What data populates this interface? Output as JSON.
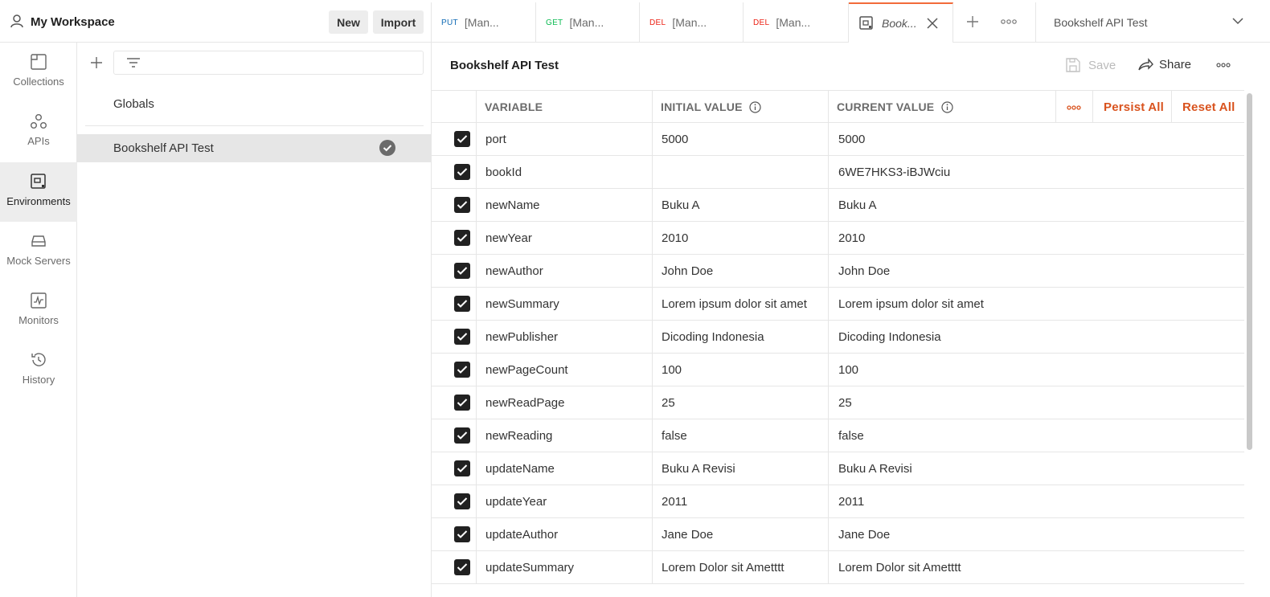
{
  "workspace": {
    "title": "My Workspace",
    "new_label": "New",
    "import_label": "Import"
  },
  "tabs": [
    {
      "method": "PUT",
      "method_color": "#0f6ab4",
      "label": "[Man..."
    },
    {
      "method": "GET",
      "method_color": "#0cbb52",
      "label": "[Man..."
    },
    {
      "method": "DEL",
      "method_color": "#eb2013",
      "label": "[Man..."
    },
    {
      "method": "DEL",
      "method_color": "#eb2013",
      "label": "[Man..."
    },
    {
      "label": "Book..."
    }
  ],
  "env_selector": "Bookshelf API Test",
  "rail": [
    {
      "label": "Collections",
      "icon": "collections-icon"
    },
    {
      "label": "APIs",
      "icon": "apis-icon"
    },
    {
      "label": "Environments",
      "icon": "environments-icon"
    },
    {
      "label": "Mock Servers",
      "icon": "mock-servers-icon"
    },
    {
      "label": "Monitors",
      "icon": "monitors-icon"
    },
    {
      "label": "History",
      "icon": "history-icon"
    }
  ],
  "env_list": {
    "globals": "Globals",
    "items": [
      "Bookshelf API Test"
    ]
  },
  "main": {
    "title": "Bookshelf API Test",
    "save_label": "Save",
    "share_label": "Share",
    "persist_all": "Persist All",
    "reset_all": "Reset All"
  },
  "table": {
    "headers": {
      "variable": "VARIABLE",
      "initial": "INITIAL VALUE",
      "current": "CURRENT VALUE"
    },
    "rows": [
      {
        "variable": "port",
        "initial": "5000",
        "current": "5000"
      },
      {
        "variable": "bookId",
        "initial": "",
        "current": "6WE7HKS3-iBJWciu"
      },
      {
        "variable": "newName",
        "initial": "Buku A",
        "current": "Buku A"
      },
      {
        "variable": "newYear",
        "initial": "2010",
        "current": "2010"
      },
      {
        "variable": "newAuthor",
        "initial": "John Doe",
        "current": "John Doe"
      },
      {
        "variable": "newSummary",
        "initial": "Lorem ipsum dolor sit amet",
        "current": "Lorem ipsum dolor sit amet"
      },
      {
        "variable": "newPublisher",
        "initial": "Dicoding Indonesia",
        "current": "Dicoding Indonesia"
      },
      {
        "variable": "newPageCount",
        "initial": "100",
        "current": "100"
      },
      {
        "variable": "newReadPage",
        "initial": "25",
        "current": "25"
      },
      {
        "variable": "newReading",
        "initial": "false",
        "current": "false"
      },
      {
        "variable": "updateName",
        "initial": "Buku A Revisi",
        "current": "Buku A Revisi"
      },
      {
        "variable": "updateYear",
        "initial": "2011",
        "current": "2011"
      },
      {
        "variable": "updateAuthor",
        "initial": "Jane Doe",
        "current": "Jane Doe"
      },
      {
        "variable": "updateSummary",
        "initial": "Lorem Dolor sit Ametttt",
        "current": "Lorem Dolor sit Ametttt"
      }
    ]
  },
  "colors": {
    "accent": "#d9531e"
  }
}
